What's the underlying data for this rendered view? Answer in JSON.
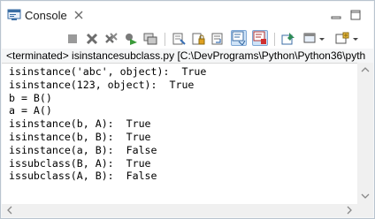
{
  "view": {
    "tab_label": "Console",
    "tab_close_icon": "close-icon",
    "minimize_icon": "minimize-icon",
    "maximize_icon": "maximize-icon"
  },
  "toolbar": {
    "icons": [
      "terminate-icon",
      "remove-launch-icon",
      "remove-all-terminated-icon",
      "debug-relaunch-icon",
      "copy-console-icon",
      "clear-console-icon",
      "scroll-lock-icon",
      "word-wrap-icon",
      "show-console-on-stdout-icon",
      "show-console-on-stderr-icon",
      "pin-console-icon",
      "display-selected-console-icon",
      "open-console-icon"
    ]
  },
  "console": {
    "header_tag": "<terminated>",
    "header_path": " isinstancesubclass.py [C:\\DevPrograms\\Python\\Python36\\pyth",
    "lines": [
      "isinstance('abc', object):  True",
      "isinstance(123, object):  True",
      "b = B()",
      "a = A()",
      "isinstance(b, A):  True",
      "isinstance(b, B):  True",
      "isinstance(a, B):  False",
      "issubclass(B, A):  True",
      "issubclass(A, B):  False"
    ]
  },
  "colors": {
    "frame_border": "#b9c4cf",
    "pressed_bg": "#cfe3f7"
  }
}
